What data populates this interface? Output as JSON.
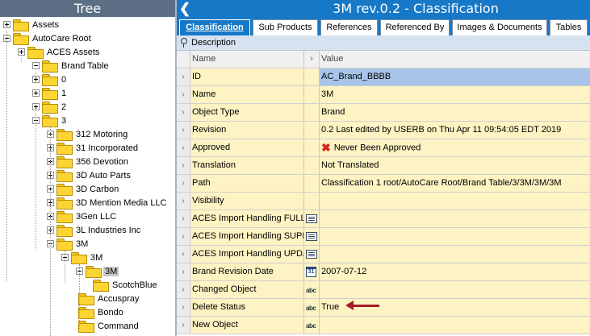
{
  "tree": {
    "header": "Tree",
    "nodes": [
      {
        "label": "Assets",
        "expander": "plus"
      },
      {
        "label": "AutoCare Root",
        "expander": "minus"
      },
      {
        "label": "ACES Assets",
        "expander": "plus"
      },
      {
        "label": "Brand Table",
        "expander": "minus"
      },
      {
        "label": "0",
        "expander": "plus"
      },
      {
        "label": "1",
        "expander": "plus"
      },
      {
        "label": "2",
        "expander": "plus"
      },
      {
        "label": "3",
        "expander": "minus"
      },
      {
        "label": "312 Motoring",
        "expander": "plus"
      },
      {
        "label": "31 Incorporated",
        "expander": "plus"
      },
      {
        "label": "356 Devotion",
        "expander": "plus"
      },
      {
        "label": "3D Auto Parts",
        "expander": "plus"
      },
      {
        "label": "3D Carbon",
        "expander": "plus"
      },
      {
        "label": "3D Mention Media LLC",
        "expander": "plus"
      },
      {
        "label": "3Gen LLC",
        "expander": "plus"
      },
      {
        "label": "3L Industries Inc",
        "expander": "plus"
      },
      {
        "label": "3M",
        "expander": "minus"
      },
      {
        "label": "3M",
        "expander": "minus"
      },
      {
        "label": "3M",
        "expander": "minus",
        "selected": true
      },
      {
        "label": "ScotchBlue",
        "expander": "none"
      },
      {
        "label": "Accuspray",
        "expander": "none"
      },
      {
        "label": "Bondo",
        "expander": "none"
      },
      {
        "label": "Command",
        "expander": "none"
      }
    ]
  },
  "header": {
    "back_icon": "back-arrow-icon",
    "title": "3M rev.0.2 - Classification"
  },
  "tabs": [
    {
      "label": "Classification",
      "active": true
    },
    {
      "label": "Sub Products"
    },
    {
      "label": "References"
    },
    {
      "label": "Referenced By"
    },
    {
      "label": "Images & Documents"
    },
    {
      "label": "Tables"
    }
  ],
  "description_label": "Description",
  "grid": {
    "columns": {
      "name": "Name",
      "sort": "›",
      "value": "Value"
    },
    "rows": [
      {
        "name": "ID",
        "icon": "",
        "value": "AC_Brand_BBBB",
        "highlight": true
      },
      {
        "name": "Name",
        "icon": "",
        "value": "3M"
      },
      {
        "name": "Object Type",
        "icon": "",
        "value": "Brand"
      },
      {
        "name": "Revision",
        "icon": "",
        "value": "0.2 Last edited by USERB on Thu Apr 11 09:54:05 EDT 2019"
      },
      {
        "name": "Approved",
        "icon": "",
        "value": "Never Been Approved",
        "status_icon": "red-x-icon"
      },
      {
        "name": "Translation",
        "icon": "",
        "value": "Not Translated"
      },
      {
        "name": "Path",
        "icon": "",
        "value": "Classification 1 root/AutoCare Root/Brand Table/3/3M/3M/3M"
      },
      {
        "name": "Visibility",
        "icon": "",
        "value": ""
      },
      {
        "name": "ACES Import Handling FULL",
        "icon": "list-icon",
        "value": ""
      },
      {
        "name": "ACES Import Handling SUPPLEMENTAL",
        "icon": "list-icon",
        "value": ""
      },
      {
        "name": "ACES Import Handling UPDATE",
        "icon": "list-icon",
        "value": ""
      },
      {
        "name": "Brand Revision Date",
        "icon": "calendar-icon",
        "value": "2007-07-12"
      },
      {
        "name": "Changed Object",
        "icon": "text-icon",
        "value": ""
      },
      {
        "name": "Delete Status",
        "icon": "text-icon",
        "value": "True"
      },
      {
        "name": "New Object",
        "icon": "text-icon",
        "value": ""
      }
    ],
    "row_indicator": "›",
    "calendar_glyph": "31",
    "text_glyph": "abc",
    "x_glyph": "✖"
  },
  "colors": {
    "accent": "#1778c7",
    "annotation_arrow": "#a51c24",
    "row_bg": "#fdf3c3",
    "highlight": "#a8c4e8"
  }
}
